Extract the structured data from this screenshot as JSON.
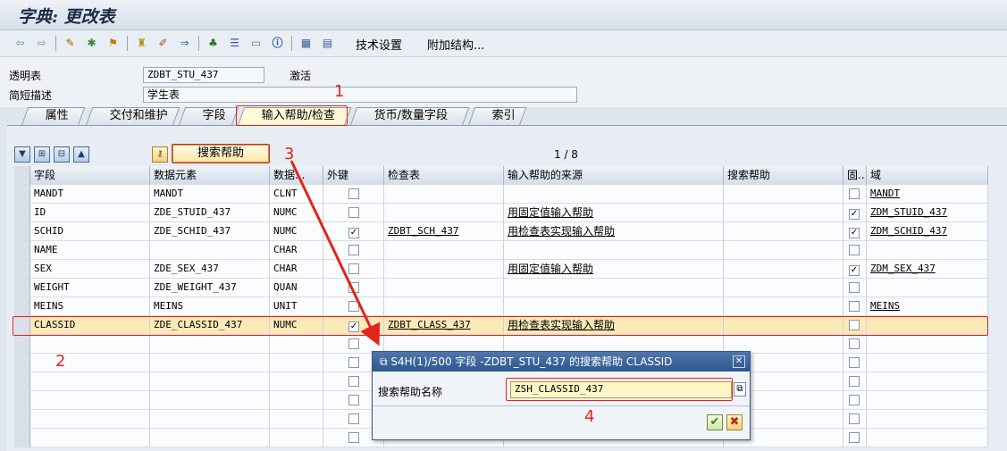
{
  "window": {
    "title": "字典: 更改表"
  },
  "toolbar": {
    "tech_settings": "技术设置",
    "append_structure": "附加结构..."
  },
  "header": {
    "table_label": "透明表",
    "table_name": "ZDBT_STU_437",
    "status": "激活",
    "desc_label": "简短描述",
    "description": "学生表"
  },
  "tabs": [
    {
      "label": "属性"
    },
    {
      "label": "交付和维护"
    },
    {
      "label": "字段"
    },
    {
      "label": "输入帮助/检查",
      "active": true
    },
    {
      "label": "货币/数量字段"
    },
    {
      "label": "索引"
    }
  ],
  "grid_tools": {
    "search_help_button": "搜索帮助",
    "page_info": "1 / 8"
  },
  "columns": [
    "字段",
    "数据元素",
    "数据...",
    "外键",
    "检查表",
    "输入帮助的来源",
    "搜索帮助",
    "固..",
    "域"
  ],
  "rows": [
    {
      "field": "MANDT",
      "element": "MANDT",
      "type": "CLNT",
      "fk": false,
      "check_table": "",
      "source": "",
      "search_help": "",
      "fixed": false,
      "domain": "MANDT"
    },
    {
      "field": "ID",
      "element": "ZDE_STUID_437",
      "type": "NUMC",
      "fk": false,
      "check_table": "",
      "source": "用固定值输入帮助",
      "search_help": "",
      "fixed": true,
      "domain": "ZDM_STUID_437"
    },
    {
      "field": "SCHID",
      "element": "ZDE_SCHID_437",
      "type": "NUMC",
      "fk": true,
      "check_table": "ZDBT_SCH_437",
      "source": "用检查表实现输入帮助",
      "search_help": "",
      "fixed": true,
      "domain": "ZDM_SCHID_437"
    },
    {
      "field": "NAME",
      "element": "",
      "type": "CHAR",
      "fk": false,
      "check_table": "",
      "source": "",
      "search_help": "",
      "fixed": false,
      "domain": ""
    },
    {
      "field": "SEX",
      "element": "ZDE_SEX_437",
      "type": "CHAR",
      "fk": false,
      "check_table": "",
      "source": "用固定值输入帮助",
      "search_help": "",
      "fixed": true,
      "domain": "ZDM_SEX_437"
    },
    {
      "field": "WEIGHT",
      "element": "ZDE_WEIGHT_437",
      "type": "QUAN",
      "fk": false,
      "check_table": "",
      "source": "",
      "search_help": "",
      "fixed": false,
      "domain": ""
    },
    {
      "field": "MEINS",
      "element": "MEINS",
      "type": "UNIT",
      "fk": false,
      "check_table": "",
      "source": "",
      "search_help": "",
      "fixed": false,
      "domain": "MEINS"
    },
    {
      "field": "CLASSID",
      "element": "ZDE_CLASSID_437",
      "type": "NUMC",
      "fk": true,
      "check_table": "ZDBT_CLASS_437",
      "source": "用检查表实现输入帮助",
      "search_help": "",
      "fixed": false,
      "domain": ""
    }
  ],
  "popup": {
    "title": "S4H(1)/500 字段 -ZDBT_STU_437 的搜索帮助 CLASSID",
    "label": "搜索帮助名称",
    "value": "ZSH_CLASSID_437"
  },
  "annotations": [
    "1",
    "2",
    "3",
    "4"
  ],
  "colors": {
    "annotation": "#e4231b",
    "highlight_row": "#fbe9b7",
    "popup_title": "#2e568f"
  }
}
